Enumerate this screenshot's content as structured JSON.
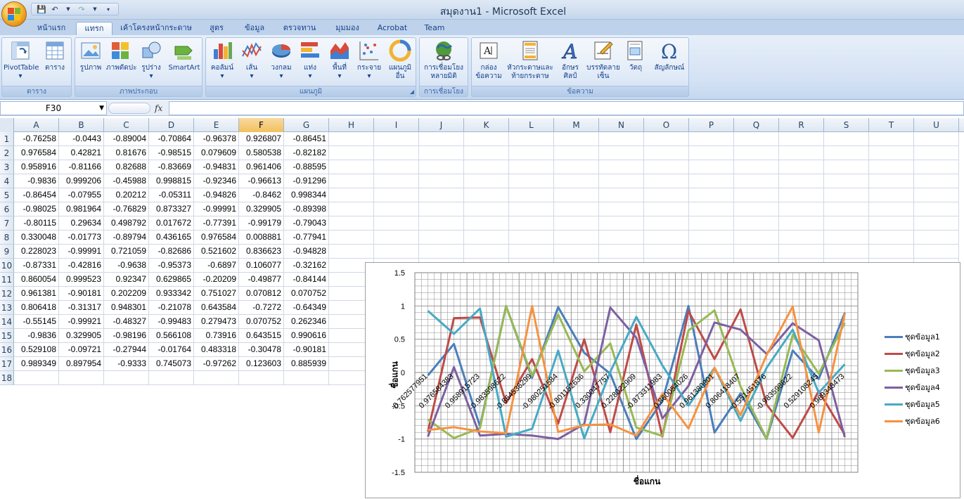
{
  "window": {
    "title": "สมุดงาน1 - Microsoft Excel"
  },
  "qat": {
    "icons": [
      "save-icon",
      "undo-icon",
      "redo-icon",
      "customize-icon"
    ]
  },
  "tabs": [
    {
      "label": "หน้าแรก",
      "active": false
    },
    {
      "label": "แทรก",
      "active": true
    },
    {
      "label": "เค้าโครงหน้ากระดาษ",
      "active": false
    },
    {
      "label": "สูตร",
      "active": false
    },
    {
      "label": "ข้อมูล",
      "active": false
    },
    {
      "label": "ตรวจทาน",
      "active": false
    },
    {
      "label": "มุมมอง",
      "active": false
    },
    {
      "label": "Acrobat",
      "active": false
    },
    {
      "label": "Team",
      "active": false
    }
  ],
  "ribbon": {
    "groups": [
      {
        "label": "ตาราง",
        "buttons": [
          {
            "label": "PivotTable",
            "icon": "pivottable-icon"
          },
          {
            "label": "ตาราง",
            "icon": "table-icon"
          }
        ]
      },
      {
        "label": "ภาพประกอบ",
        "buttons": [
          {
            "label": "รูปภาพ",
            "icon": "picture-icon"
          },
          {
            "label": "ภาพตัดปะ",
            "icon": "clipart-icon"
          },
          {
            "label": "รูปร่าง",
            "icon": "shapes-icon"
          },
          {
            "label": "SmartArt",
            "icon": "smartart-icon"
          }
        ]
      },
      {
        "label": "แผนภูมิ",
        "buttons": [
          {
            "label": "คอลัมน์",
            "icon": "column-chart-icon"
          },
          {
            "label": "เส้น",
            "icon": "line-chart-icon"
          },
          {
            "label": "วงกลม",
            "icon": "pie-chart-icon"
          },
          {
            "label": "แท่ง",
            "icon": "bar-chart-icon"
          },
          {
            "label": "พื้นที่",
            "icon": "area-chart-icon"
          },
          {
            "label": "กระจาย",
            "icon": "scatter-chart-icon"
          },
          {
            "label": "แผนภูมิอื่น",
            "icon": "other-chart-icon"
          }
        ]
      },
      {
        "label": "การเชื่อมโยง",
        "buttons": [
          {
            "label": "การเชื่อมโยงหลายมิติ",
            "icon": "hyperlink-icon"
          }
        ]
      },
      {
        "label": "ข้อความ",
        "buttons": [
          {
            "label": "กล่องข้อความ",
            "icon": "textbox-icon"
          },
          {
            "label": "หัวกระดาษและท้ายกระดาษ",
            "icon": "header-footer-icon"
          },
          {
            "label": "อักษรศิลป์",
            "icon": "wordart-icon"
          },
          {
            "label": "บรรทัดลายเซ็น",
            "icon": "signature-line-icon"
          },
          {
            "label": "วัตถุ",
            "icon": "object-icon"
          },
          {
            "label": "สัญลักษณ์",
            "icon": "symbol-icon"
          }
        ]
      }
    ]
  },
  "formula_bar": {
    "name_box": "F30",
    "fx_label": "fx",
    "formula": ""
  },
  "sheet": {
    "columns": [
      "A",
      "B",
      "C",
      "D",
      "E",
      "F",
      "G",
      "H",
      "I",
      "J",
      "K",
      "L",
      "M",
      "N",
      "O",
      "P",
      "Q",
      "R",
      "S",
      "T",
      "U"
    ],
    "selected_column": "F",
    "row_numbers": [
      "1",
      "2",
      "3",
      "4",
      "5",
      "6",
      "7",
      "8",
      "9",
      "10",
      "11",
      "12",
      "13",
      "14",
      "15",
      "16",
      "17",
      "18"
    ],
    "cells": [
      [
        "-0.76258",
        "-0.0443",
        "-0.89004",
        "-0.70864",
        "-0.96378",
        "0.926807",
        "-0.86451"
      ],
      [
        "0.976584",
        "0.42821",
        "0.81676",
        "-0.98515",
        "0.079609",
        "0.580538",
        "-0.82182"
      ],
      [
        "0.958916",
        "-0.81166",
        "0.82688",
        "-0.83669",
        "-0.94831",
        "0.961406",
        "-0.88595"
      ],
      [
        "-0.9836",
        "0.999206",
        "-0.45988",
        "0.998815",
        "-0.92346",
        "-0.96613",
        "-0.91296"
      ],
      [
        "-0.86454",
        "-0.07955",
        "0.20212",
        "-0.05311",
        "-0.94826",
        "-0.8462",
        "0.998344"
      ],
      [
        "-0.98025",
        "0.981964",
        "-0.76829",
        "0.873327",
        "-0.99991",
        "0.329905",
        "-0.89398"
      ],
      [
        "-0.80115",
        "0.29634",
        "0.498792",
        "0.017672",
        "-0.77391",
        "-0.99179",
        "-0.79043"
      ],
      [
        "0.330048",
        "-0.01773",
        "-0.89794",
        "0.436165",
        "0.976584",
        "0.008881",
        "-0.77941"
      ],
      [
        "0.228023",
        "-0.99991",
        "0.721059",
        "-0.82686",
        "0.521602",
        "0.836623",
        "-0.94828"
      ],
      [
        "-0.87331",
        "-0.42816",
        "-0.9638",
        "-0.95373",
        "-0.6897",
        "0.106077",
        "-0.32162"
      ],
      [
        "0.860054",
        "0.999523",
        "0.92347",
        "0.629865",
        "-0.20209",
        "-0.49877",
        "-0.84144"
      ],
      [
        "0.961381",
        "-0.90181",
        "0.202209",
        "0.933342",
        "0.751027",
        "0.070812",
        "0.070752"
      ],
      [
        "0.806418",
        "-0.31317",
        "0.948301",
        "-0.21078",
        "0.643584",
        "-0.7272",
        "-0.64349"
      ],
      [
        "-0.55145",
        "-0.99921",
        "-0.48327",
        "-0.99483",
        "0.279473",
        "0.070752",
        "0.262346"
      ],
      [
        "-0.9836",
        "0.329905",
        "-0.98196",
        "0.566108",
        "0.73916",
        "0.643515",
        "0.990616"
      ],
      [
        "0.529108",
        "-0.09721",
        "-0.27944",
        "-0.01764",
        "0.483318",
        "-0.30478",
        "-0.90181"
      ],
      [
        "0.989349",
        "0.897954",
        "-0.9333",
        "0.745073",
        "-0.97262",
        "0.123603",
        "0.885939"
      ],
      [
        "",
        "",
        "",
        "",
        "",
        "",
        ""
      ]
    ]
  },
  "chart_data": {
    "type": "line",
    "xlabel": "ชื่อแกน",
    "ylabel": "ชื่อแกน",
    "ylim": [
      -1.5,
      1.5
    ],
    "yticks": [
      "1.5",
      "1",
      "0.5",
      "0",
      "-0.5",
      "-1",
      "-1.5"
    ],
    "categories": [
      "-0.762577951",
      "0.976584383",
      "0.958915723",
      "-0.983598622",
      "-0.864536299",
      "-0.980251584",
      "-0.801152636",
      "0.330047757",
      "0.228022909",
      "-0.873311983",
      "0.860054026",
      "0.961380901",
      "0.806418407",
      "-0.551451876",
      "-0.983598622",
      "0.529108245",
      "0.989348473"
    ],
    "colors": [
      "#4a7ebb",
      "#be4b48",
      "#98b954",
      "#7d60a0",
      "#46aac5",
      "#f69240"
    ],
    "series": [
      {
        "name": "ชุดข้อมูล1",
        "values": [
          -0.0443,
          0.42821,
          -0.81166,
          0.999206,
          -0.07955,
          0.981964,
          0.29634,
          -0.01773,
          -0.99991,
          -0.42816,
          0.999523,
          -0.90181,
          -0.31317,
          -0.99921,
          0.329905,
          -0.09721,
          0.897954
        ]
      },
      {
        "name": "ชุดข้อมูล2",
        "values": [
          -0.89004,
          0.81676,
          0.82688,
          -0.45988,
          0.20212,
          -0.76829,
          0.498792,
          -0.89794,
          0.721059,
          -0.9638,
          0.92347,
          0.202209,
          0.948301,
          -0.48327,
          -0.98196,
          -0.27944,
          -0.9333
        ]
      },
      {
        "name": "ชุดข้อมูล3",
        "values": [
          -0.70864,
          -0.98515,
          -0.83669,
          0.998815,
          -0.05311,
          0.873327,
          0.017672,
          0.436165,
          -0.82686,
          -0.95373,
          0.629865,
          0.933342,
          -0.21078,
          -0.99483,
          0.566108,
          -0.01764,
          0.745073
        ]
      },
      {
        "name": "ชุดข้อมูล4",
        "values": [
          -0.96378,
          0.079609,
          -0.94831,
          -0.92346,
          -0.94826,
          -0.99991,
          -0.77391,
          0.976584,
          0.521602,
          -0.6897,
          -0.20209,
          0.751027,
          0.643584,
          0.279473,
          0.73916,
          0.483318,
          -0.97262
        ]
      },
      {
        "name": "ชุดข้อมูล5",
        "values": [
          0.926807,
          0.580538,
          0.961406,
          -0.96613,
          -0.8462,
          0.329905,
          -0.99179,
          0.008881,
          0.836623,
          0.106077,
          -0.49877,
          0.070812,
          -0.7272,
          0.070752,
          0.643515,
          -0.30478,
          0.123603
        ]
      },
      {
        "name": "ชุดข้อมูล6",
        "values": [
          -0.86451,
          -0.82182,
          -0.88595,
          -0.91296,
          0.998344,
          -0.89398,
          -0.79043,
          -0.77941,
          -0.94828,
          -0.32162,
          -0.84144,
          0.070752,
          -0.64349,
          0.262346,
          0.990616,
          -0.90181,
          0.885939
        ]
      }
    ]
  }
}
